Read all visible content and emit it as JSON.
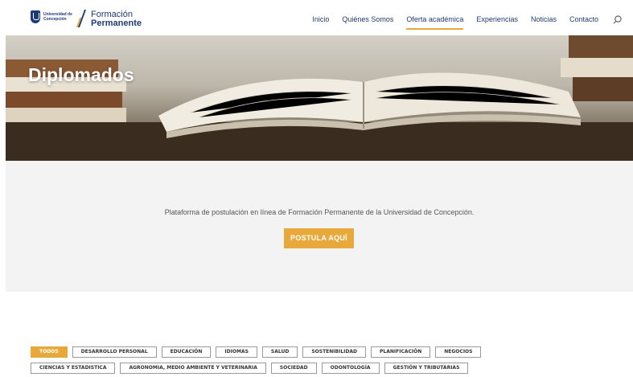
{
  "header": {
    "udec_logo_text": "Universidad de Concepción",
    "brand_top": "Formación",
    "brand_bottom": "Permanente",
    "nav": [
      "Inicio",
      "Quiénes Somos",
      "Oferta académica",
      "Experiencias",
      "Noticias",
      "Contacto"
    ],
    "active_nav": "Oferta académica",
    "search_icon": "search-icon"
  },
  "hero": {
    "title": "Diplomados"
  },
  "info": {
    "text": "Plataforma de postulación en línea de Formación Permanente de la Universidad de Concepción.",
    "cta_label": "POSTULA AQUÍ"
  },
  "filters": {
    "row1": [
      "TODOS",
      "DESARROLLO PERSONAL",
      "EDUCACIÓN",
      "IDIOMAS",
      "SALUD",
      "SOSTENIBILIDAD",
      "PLANIFICACIÓN",
      "NEGOCIOS"
    ],
    "row2": [
      "CIENCIAS Y ESTADISTICA",
      "AGRONOMIA, MEDIO AMBIENTE Y VETERINARIA",
      "SOCIEDAD",
      "ODONTOLOGÍA",
      "GESTIÓN Y TRIBUTARIAS"
    ],
    "active": "TODOS"
  },
  "colors": {
    "brand_blue": "#1f3a78",
    "accent": "#e8a93a",
    "section_bg": "#f3f3f3"
  }
}
